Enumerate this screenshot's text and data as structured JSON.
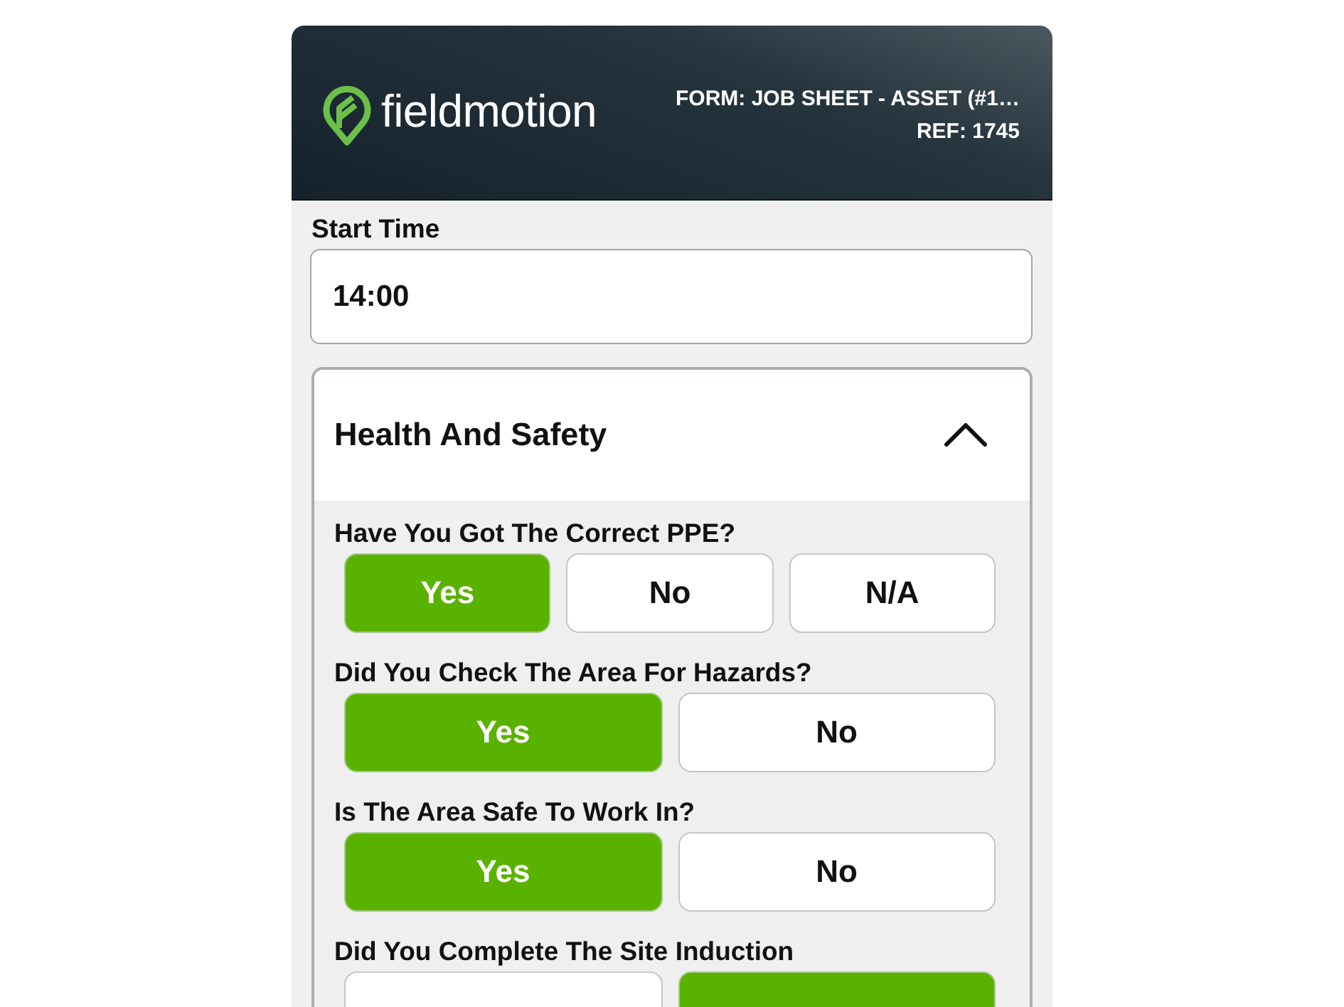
{
  "header": {
    "logo_text": "fieldmotion",
    "form_title": "FORM: JOB SHEET - ASSET (#1…",
    "reference": "REF: 1745"
  },
  "fields": [
    {
      "label": "Start Time",
      "value": "14:00"
    }
  ],
  "section": {
    "title": "Health And Safety",
    "expanded": true,
    "questions": [
      {
        "label": "Have You Got The Correct PPE?",
        "options": [
          {
            "label": "Yes",
            "selected": true
          },
          {
            "label": "No",
            "selected": false
          },
          {
            "label": "N/A",
            "selected": false
          }
        ]
      },
      {
        "label": "Did You Check The Area For Hazards?",
        "options": [
          {
            "label": "Yes",
            "selected": true
          },
          {
            "label": "No",
            "selected": false
          }
        ]
      },
      {
        "label": "Is The Area Safe To Work In?",
        "options": [
          {
            "label": "Yes",
            "selected": true
          },
          {
            "label": "No",
            "selected": false
          }
        ]
      },
      {
        "label": "Did You Complete The Site Induction",
        "options": [
          {
            "selected": false
          },
          {
            "selected": true
          }
        ]
      }
    ]
  }
}
